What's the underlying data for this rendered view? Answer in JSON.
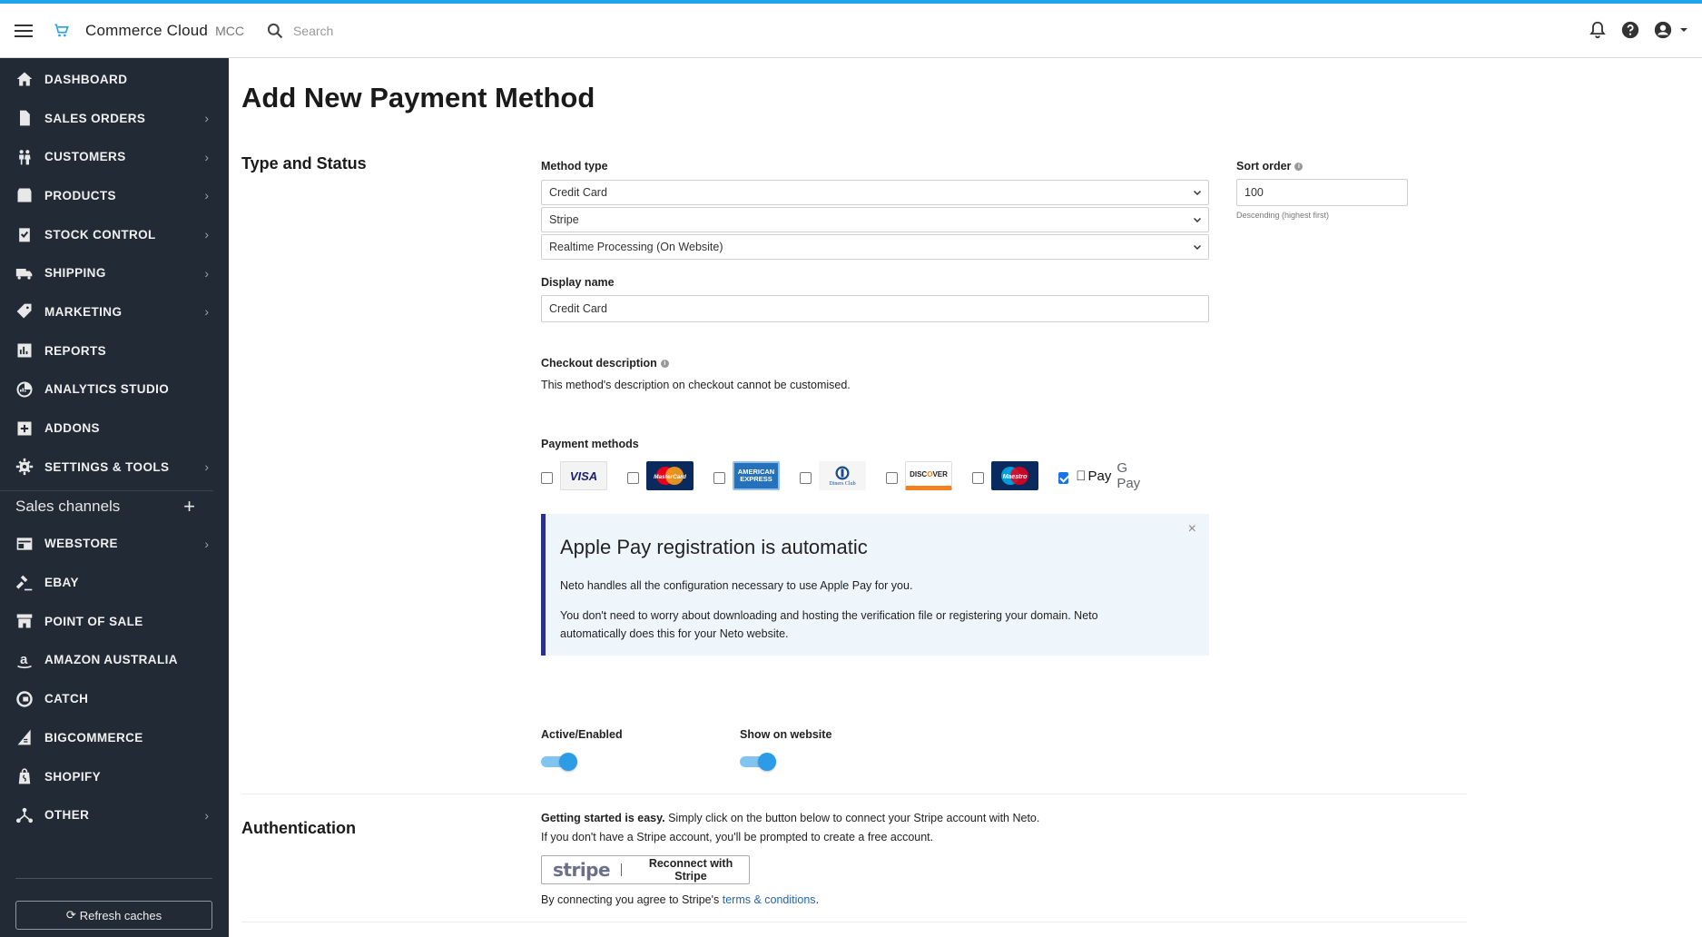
{
  "topbar": {
    "app_title": "Commerce Cloud",
    "app_sub": "MCC",
    "search_placeholder": "Search"
  },
  "sidebar": {
    "items": [
      {
        "label": "DASHBOARD",
        "icon": "home-icon",
        "chevron": false
      },
      {
        "label": "SALES ORDERS",
        "icon": "document-icon",
        "chevron": true
      },
      {
        "label": "CUSTOMERS",
        "icon": "people-icon",
        "chevron": true
      },
      {
        "label": "PRODUCTS",
        "icon": "box-icon",
        "chevron": true
      },
      {
        "label": "STOCK CONTROL",
        "icon": "clipboard-check-icon",
        "chevron": true
      },
      {
        "label": "SHIPPING",
        "icon": "truck-icon",
        "chevron": true
      },
      {
        "label": "MARKETING",
        "icon": "tag-icon",
        "chevron": true
      },
      {
        "label": "REPORTS",
        "icon": "bar-chart-icon",
        "chevron": false
      },
      {
        "label": "ANALYTICS STUDIO",
        "icon": "analytics-icon",
        "chevron": false
      },
      {
        "label": "ADDONS",
        "icon": "plus-square-icon",
        "chevron": false
      },
      {
        "label": "SETTINGS & TOOLS",
        "icon": "gear-icon",
        "chevron": true
      }
    ],
    "channels_label": "Sales channels",
    "channels": [
      {
        "label": "WEBSTORE",
        "icon": "webstore-icon",
        "chevron": true
      },
      {
        "label": "EBAY",
        "icon": "gavel-icon",
        "chevron": false
      },
      {
        "label": "POINT OF SALE",
        "icon": "store-icon",
        "chevron": false
      },
      {
        "label": "AMAZON AUSTRALIA",
        "icon": "amazon-icon",
        "chevron": false
      },
      {
        "label": "CATCH",
        "icon": "catch-icon",
        "chevron": false
      },
      {
        "label": "BIGCOMMERCE",
        "icon": "bigcommerce-icon",
        "chevron": false
      },
      {
        "label": "SHOPIFY",
        "icon": "shopify-icon",
        "chevron": false
      },
      {
        "label": "OTHER",
        "icon": "network-icon",
        "chevron": true
      }
    ],
    "refresh_label": "Refresh caches"
  },
  "main": {
    "page_title": "Add New Payment Method",
    "type_status_title": "Type and Status",
    "method_type_label": "Method type",
    "method_type_values": [
      "Credit Card",
      "Stripe",
      "Realtime Processing (On Website)"
    ],
    "sort_order_label": "Sort order",
    "sort_order_value": "100",
    "sort_order_hint": "Descending (highest first)",
    "display_name_label": "Display name",
    "display_name_value": "Credit Card",
    "checkout_desc_label": "Checkout description",
    "checkout_desc_text": "This method's description on checkout cannot be customised.",
    "payment_methods_label": "Payment methods",
    "payment_methods": [
      {
        "name": "VISA",
        "checked": false
      },
      {
        "name": "MasterCard",
        "checked": false
      },
      {
        "name": "AMERICAN EXPRESS",
        "checked": false
      },
      {
        "name": "Diners Club",
        "checked": false
      },
      {
        "name": "DISCOVER",
        "checked": false
      },
      {
        "name": "Maestro",
        "checked": false
      },
      {
        "name": "Apple Pay / Google Pay",
        "checked": true
      }
    ],
    "applepay_label": "Pay",
    "gpay_label": "G Pay",
    "alert": {
      "title": "Apple Pay registration is automatic",
      "p1": "Neto handles all the configuration necessary to use Apple Pay for you.",
      "p2": "You don't need to worry about downloading and hosting the verification file or registering your domain. Neto automatically does this for your Neto website."
    },
    "active_label": "Active/Enabled",
    "active_on": true,
    "show_label": "Show on website",
    "show_on": true,
    "auth_title": "Authentication",
    "auth_bold": "Getting started is easy.",
    "auth_line1": " Simply click on the button below to connect your Stripe account with Neto.",
    "auth_line2": "If you don't have a Stripe account, you'll be prompted to create a free account.",
    "stripe_logo": "stripe",
    "stripe_button": "Reconnect with Stripe",
    "agree_text": "By connecting you agree to Stripe's ",
    "terms_link": "terms & conditions",
    "agree_end": "."
  },
  "colors": {
    "accent": "#1ea4e9",
    "sidebar_bg": "#222a36",
    "toggle_on": "#2c9ce6",
    "alert_border": "#2b2f8f"
  }
}
